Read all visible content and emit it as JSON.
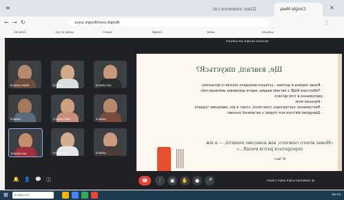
{
  "browser": {
    "tabs": [
      {
        "label": "ɔɪɪɔ ɘɔnɘɪɘʇno ɔʇɘ2|2"
      },
      {
        "label": "ʇɘɘM ɘlɡooƆ"
      }
    ],
    "address": "ɘɹɘɯ.ɘlɡooƃ/ɘɘɯ.ɘlɡooƃ",
    "bookmarks": [
      "ʎɐ·ʇɘɘƆ",
      "ɔʇǝ ɔɘ ʇɘɘɯ",
      "nɘɯɘ",
      "ɘlɡooƆ",
      "ʇɘɘɯ",
      "ɐɔɯɘɯ"
    ]
  },
  "meet": {
    "presenter_label": "ɐɔɯɐɯ ɐɯ ɐʞɐɯɘ ɐɯɔoʞɐ",
    "participants": [
      {
        "name": "ɐɔɯɘɯ ɐɯɐɘ"
      },
      {
        "name": "ɐɔɯɘɯ"
      },
      {
        "name": "ɐɔɯɘɯ ɐɯ"
      },
      {
        "name": "ɐɔɯɘɯ"
      },
      {
        "name": "ɐɔɯɘɯ ɐɯɐ"
      },
      {
        "name": "ɐɔɯɘɯ"
      },
      {
        "name": "ɐɔɯɘɯ ɐɯ"
      },
      {
        "name": "ɐɔɯɘɯ ɐɯ"
      },
      {
        "name": "ɐɔɯɘɯ"
      }
    ],
    "meeting_info": "ǝɔɯɐ | ɐʞɐɯ ɐʞɐɯ ɐʞɐɯɐɯɐ ʞɐ"
  },
  "slide": {
    "title": "Ще, взагалі, пікуєтьсR?",
    "bullets": [
      "- Взнає хорина в дитяно - успішно виходить ніколи із організму.",
      "- Тебохтаки АЩЕ з легнем вадиш, варте доповнює аміноцистеїн",
      "харчування в тіло вр'євлі.",
      "- Імунологопія.",
      "- Нехтування: кастраторн, пластичні, спорт в ріх, хвильова тудаєлі.",
      "- Шандрові вів'єнза вся подихі з загаманої зазнаві."
    ],
    "quote": "«Немає нічого гаіжчого, ніж конкуэно пошитої, — в хіж передраться ратгів вчеціЕ...»",
    "author": "М.Твен"
  },
  "controls": {
    "left_icons": [
      "bell-icon",
      "person-icon",
      "chat-icon",
      "info-icon"
    ],
    "center_icons": [
      "hangup-icon",
      "more-icon",
      "present-icon",
      "raise-hand-icon",
      "camera-icon",
      "mic-icon"
    ]
  },
  "taskbar": {
    "search_placeholder": "ɐɔɯɐɯ ɐʞ",
    "tray_time": "ɐɯ ɐʞ"
  }
}
